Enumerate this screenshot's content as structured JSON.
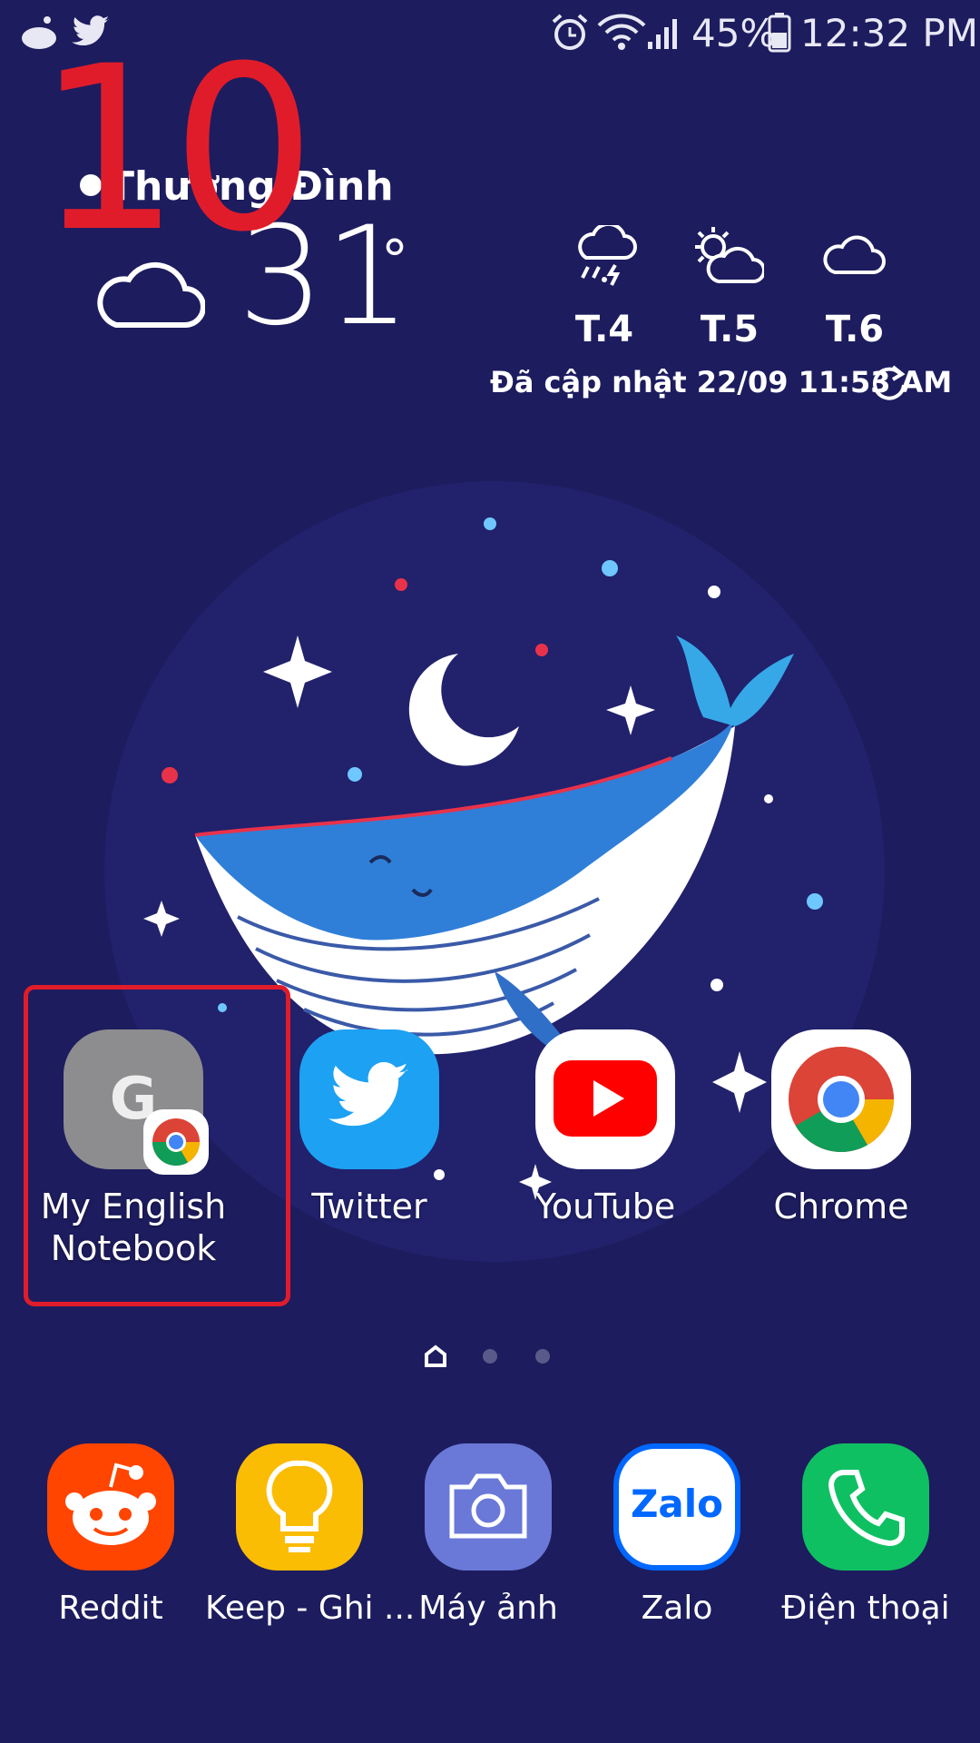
{
  "status_bar": {
    "notification_icons": [
      "reddit-icon",
      "twitter-icon"
    ],
    "system_icons": [
      "alarm-icon",
      "wifi-icon",
      "signal-icon",
      "battery-icon"
    ],
    "battery": "45%",
    "time": "12:32 PM"
  },
  "step_number": "10",
  "weather": {
    "location": "Thượng Đình",
    "temperature": "31",
    "degree_symbol": "°",
    "current_icon": "cloud-icon",
    "forecast": [
      {
        "day": "T.4",
        "icon": "rain-snow-thunder-icon"
      },
      {
        "day": "T.5",
        "icon": "partly-sunny-icon"
      },
      {
        "day": "T.6",
        "icon": "cloud-icon"
      }
    ],
    "updated": "Đã cập nhật 22/09 11:53 AM"
  },
  "home_apps": [
    {
      "label": "My English Notebook",
      "line1": "My English",
      "line2": "Notebook",
      "icon_letter": "G"
    },
    {
      "label": "Twitter"
    },
    {
      "label": "YouTube"
    },
    {
      "label": "Chrome"
    }
  ],
  "page_indicator": {
    "pages": 3,
    "current": 0
  },
  "dock": [
    {
      "label": "Reddit"
    },
    {
      "label": "Keep - Ghi ..."
    },
    {
      "label": "Máy ảnh"
    },
    {
      "label": "Zalo",
      "icon_text": "Zalo"
    },
    {
      "label": "Điện thoại"
    }
  ],
  "colors": {
    "background": "#1d1c5e",
    "highlight": "#e11c2a",
    "twitter": "#1da1f2",
    "youtube": "#ff0000",
    "reddit": "#ff4500",
    "keep": "#fbbc04",
    "camera": "#6a78d8",
    "zalo": "#0068ff",
    "phone": "#0fc063"
  }
}
